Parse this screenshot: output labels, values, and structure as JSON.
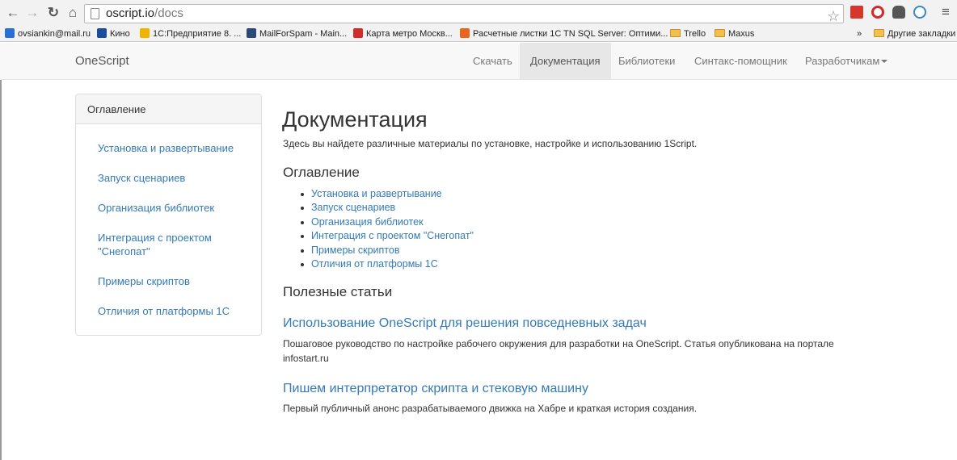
{
  "browser": {
    "url_host": "oscript.io",
    "url_path": "/docs",
    "bookmarks": [
      {
        "label": "ovsiankin@mail.ru",
        "color": "#2a6fd6"
      },
      {
        "label": "Кино",
        "color": "#1a4e9b"
      },
      {
        "label": "1С:Предприятие 8. ...",
        "color": "#f0b400"
      },
      {
        "label": "MailForSpam - Main...",
        "color": "#2b4a7a"
      },
      {
        "label": "Карта метро Москв...",
        "color": "#d22b2b"
      },
      {
        "label": "Расчетные листки 1С",
        "color": "#e8651c"
      },
      {
        "label": "TN SQL Server: Оптими...",
        "color": ""
      },
      {
        "label": "Trello",
        "color": "folder"
      },
      {
        "label": "Maxus",
        "color": "folder"
      }
    ],
    "overflow_label": "»",
    "other_bookmarks": "Другие закладки"
  },
  "site": {
    "brand": "OneScript",
    "nav": [
      {
        "label": "Скачать",
        "active": false
      },
      {
        "label": "Документация",
        "active": true
      },
      {
        "label": "Библиотеки",
        "active": false
      },
      {
        "label": "Синтакс-помощник",
        "active": false
      },
      {
        "label": "Разработчикам",
        "active": false,
        "dropdown": true
      }
    ]
  },
  "sidebar": {
    "heading": "Оглавление",
    "items": [
      "Установка и развертывание",
      "Запуск сценариев",
      "Организация библиотек",
      "Интеграция с проектом \"Снегопат\"",
      "Примеры скриптов",
      "Отличия от платформы 1С"
    ]
  },
  "main": {
    "title": "Документация",
    "lead": "Здесь вы найдете различные материалы по установке, настройке и использованию 1Script.",
    "toc_heading": "Оглавление",
    "toc": [
      "Установка и развертывание",
      "Запуск сценариев",
      "Организация библиотек",
      "Интеграция с проектом \"Снегопат\"",
      "Примеры скриптов",
      "Отличия от платформы 1С"
    ],
    "articles_heading": "Полезные статьи",
    "articles": [
      {
        "title": "Использование OneScript для решения повседневных задач",
        "desc": "Пошаговое руководство по настройке рабочего окружения для разработки на OneScript. Статья опубликована на портале infostart.ru"
      },
      {
        "title": "Пишем интерпретатор скрипта и стековую машину",
        "desc": "Первый публичный анонс разрабатываемого движка на Хабре и краткая история создания."
      }
    ]
  }
}
